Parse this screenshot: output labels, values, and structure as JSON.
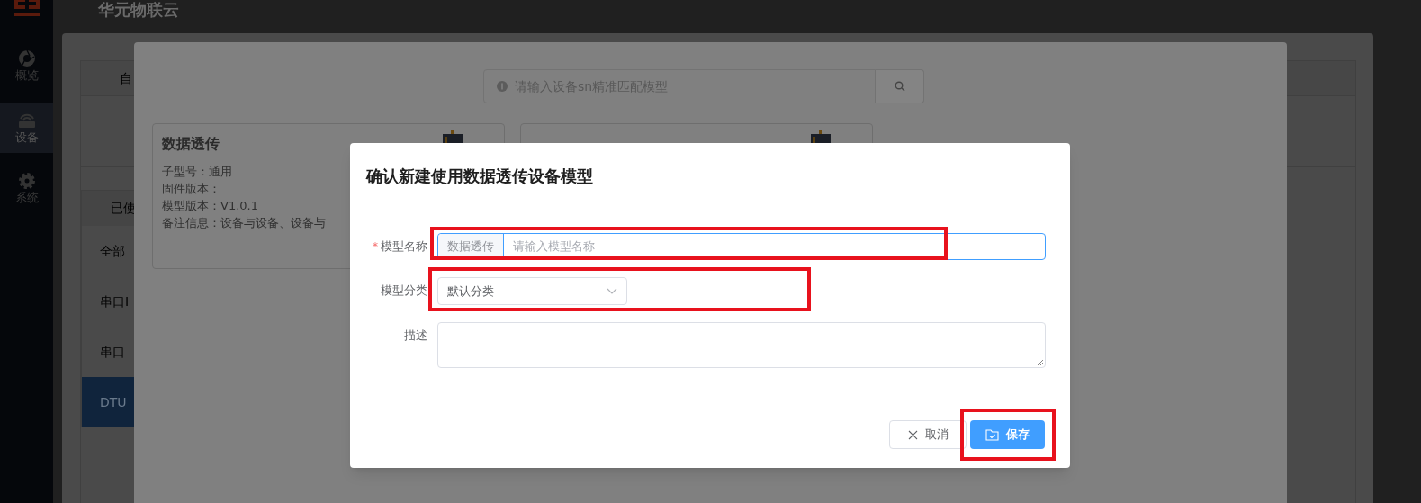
{
  "sidebar": {
    "items": [
      {
        "label": "概览",
        "selected": false
      },
      {
        "label": "设备",
        "selected": true
      },
      {
        "label": "系统",
        "selected": false
      }
    ]
  },
  "header": {
    "title": "华元物联云"
  },
  "add_device_dialog": {
    "tabs": [
      {
        "label": "自"
      }
    ],
    "category_header": "已使",
    "categories": [
      {
        "label": "全部",
        "selected": false
      },
      {
        "label": "串口I",
        "selected": false
      },
      {
        "label": "串口",
        "selected": false
      },
      {
        "label": "DTU",
        "selected": true
      }
    ]
  },
  "model_picker": {
    "search": {
      "placeholder": "请输入设备sn精准匹配模型"
    },
    "cards": [
      {
        "title": "数据透传",
        "lines": [
          "子型号：通用",
          "固件版本：",
          "模型版本：V1.0.1",
          "备注信息：设备与设备、设备与"
        ]
      }
    ]
  },
  "confirm_dialog": {
    "title": "确认新建使用数据透传设备模型",
    "fields": [
      {
        "kind": "prefixed_input",
        "label": "模型名称",
        "required_mark": "*",
        "prefix": "数据透传",
        "placeholder": "请输入模型名称",
        "highlighted": true
      },
      {
        "kind": "select",
        "label": "模型分类",
        "value": "默认分类",
        "highlighted": true
      },
      {
        "kind": "textarea",
        "label": "描述",
        "highlighted": false
      }
    ],
    "buttons": [
      {
        "kind": "cancel",
        "label": "取消",
        "highlighted": false
      },
      {
        "kind": "save",
        "label": "保存",
        "highlighted": true
      }
    ]
  }
}
